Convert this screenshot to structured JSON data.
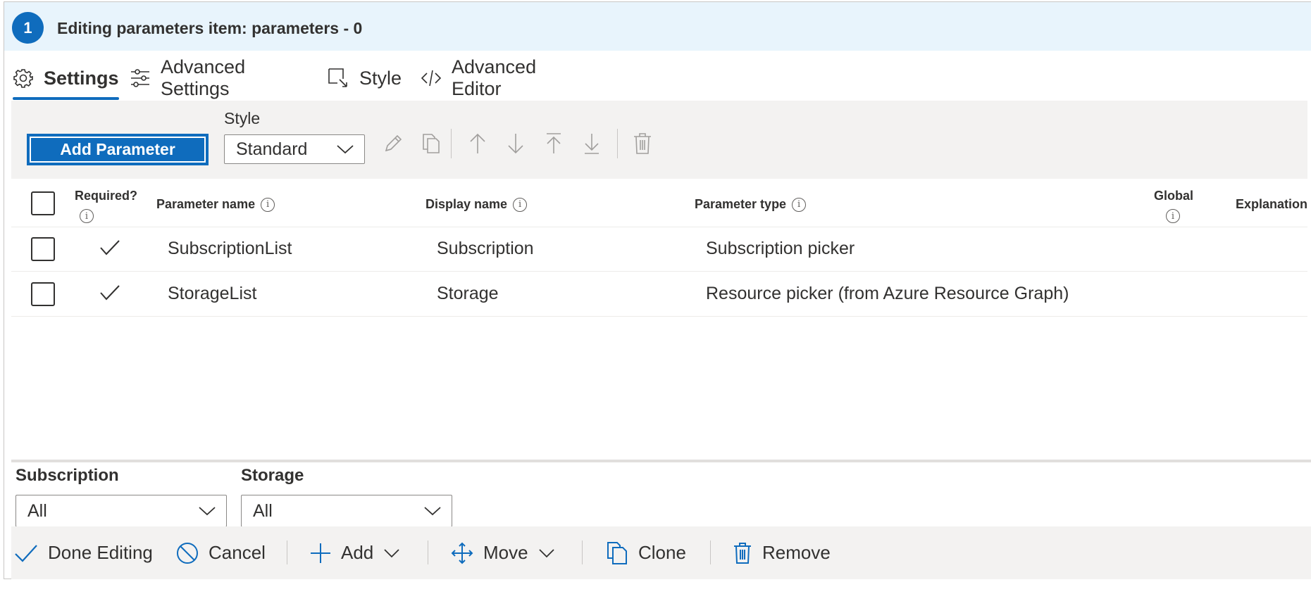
{
  "header": {
    "step": "1",
    "title": "Editing parameters item: parameters - 0"
  },
  "tabs": [
    {
      "label": "Settings",
      "icon": "gear-icon",
      "active": true
    },
    {
      "label": "Advanced Settings",
      "icon": "sliders-icon",
      "active": false
    },
    {
      "label": "Style",
      "icon": "style-icon",
      "active": false
    },
    {
      "label": "Advanced Editor",
      "icon": "code-icon",
      "active": false
    }
  ],
  "toolbar": {
    "add_parameter_label": "Add Parameter",
    "style_label": "Style",
    "style_value": "Standard",
    "icons": [
      "edit-icon",
      "copy-icon",
      "move-up-icon",
      "move-down-icon",
      "move-top-icon",
      "move-bottom-icon",
      "delete-icon"
    ]
  },
  "table": {
    "columns": {
      "required": "Required?",
      "parameter_name": "Parameter name",
      "display_name": "Display name",
      "parameter_type": "Parameter type",
      "global": "Global",
      "explanation": "Explanation"
    },
    "rows": [
      {
        "required": true,
        "parameter_name": "SubscriptionList",
        "display_name": "Subscription",
        "parameter_type": "Subscription picker"
      },
      {
        "required": true,
        "parameter_name": "StorageList",
        "display_name": "Storage",
        "parameter_type": "Resource picker (from Azure Resource Graph)"
      }
    ]
  },
  "preview": {
    "subscription": {
      "label": "Subscription",
      "value": "All"
    },
    "storage": {
      "label": "Storage",
      "value": "All"
    }
  },
  "footer": {
    "done_editing": "Done Editing",
    "cancel": "Cancel",
    "add": "Add",
    "move": "Move",
    "clone": "Clone",
    "remove": "Remove"
  },
  "colors": {
    "accent": "#0f6cbd",
    "header_bg": "#e8f4fc",
    "toolbar_bg": "#f3f2f1",
    "disabled_icon": "#a19f9d"
  }
}
